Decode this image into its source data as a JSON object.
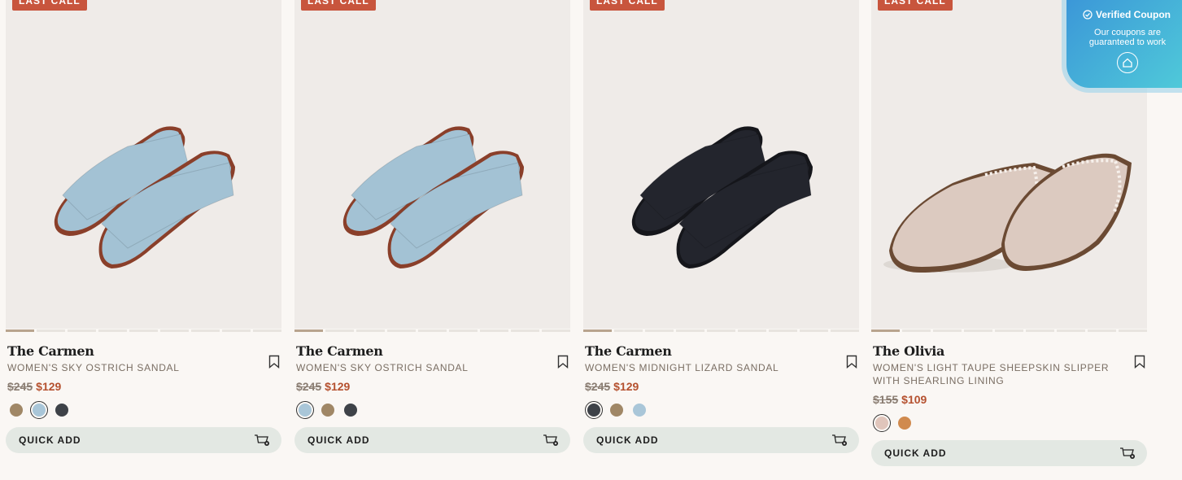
{
  "products": [
    {
      "badge": "LAST CALL",
      "title": "The Carmen",
      "subtitle": "WOMEN'S SKY OSTRICH SANDAL",
      "price_old": "$245",
      "price_new": "$129",
      "swatches": [
        {
          "color": "#a08766",
          "selected": false
        },
        {
          "color": "#a9c6d8",
          "selected": true
        },
        {
          "color": "#3e4248",
          "selected": false
        }
      ],
      "quick_add": "QUICK ADD",
      "shoe_color": "#a3c2d4",
      "sole_color": "#8a3f2a"
    },
    {
      "badge": "LAST CALL",
      "title": "The Carmen",
      "subtitle": "WOMEN'S SKY OSTRICH SANDAL",
      "price_old": "$245",
      "price_new": "$129",
      "swatches": [
        {
          "color": "#a9c6d8",
          "selected": true
        },
        {
          "color": "#a08766",
          "selected": false
        },
        {
          "color": "#3e4248",
          "selected": false
        }
      ],
      "quick_add": "QUICK ADD",
      "shoe_color": "#a3c2d4",
      "sole_color": "#8a3f2a"
    },
    {
      "badge": "LAST CALL",
      "title": "The Carmen",
      "subtitle": "WOMEN'S MIDNIGHT LIZARD SANDAL",
      "price_old": "$245",
      "price_new": "$129",
      "swatches": [
        {
          "color": "#3e4248",
          "selected": true
        },
        {
          "color": "#a08766",
          "selected": false
        },
        {
          "color": "#a9c6d8",
          "selected": false
        }
      ],
      "quick_add": "QUICK ADD",
      "shoe_color": "#23252d",
      "sole_color": "#15161b"
    },
    {
      "badge": "LAST CALL",
      "title": "The Olivia",
      "subtitle": "WOMEN'S LIGHT TAUPE SHEEPSKIN SLIPPER WITH SHEARLING LINING",
      "price_old": "$155",
      "price_new": "$109",
      "swatches": [
        {
          "color": "#e0c5bb",
          "selected": true
        },
        {
          "color": "#d08a4e",
          "selected": false
        }
      ],
      "quick_add": "QUICK ADD",
      "shoe_color": "#dccac0",
      "sole_color": "#6b4a33"
    }
  ],
  "coupon": {
    "heading": "Verified Coupon",
    "line1": "Our coupons are",
    "line2": "guaranteed to work"
  },
  "colors": {
    "badge": "#c8553d",
    "sale_price": "#b5512f",
    "quick_add_bg": "#e3e8e3",
    "coupon_from": "#3b96d8",
    "coupon_to": "#4fc9d9"
  }
}
